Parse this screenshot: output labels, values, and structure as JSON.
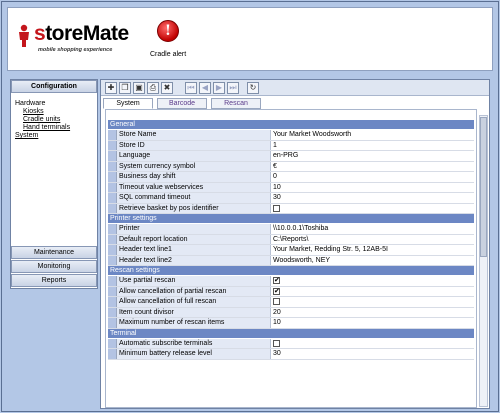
{
  "brand": {
    "logo_s": "s",
    "logo_text": "toreMate",
    "tagline": "mobile shopping experience"
  },
  "alert": {
    "label": "Cradle alert",
    "icon": "alert-icon"
  },
  "sidebar": {
    "configuration": "Configuration",
    "tree": {
      "hardware": "Hardware",
      "kiosks": "Kiosks",
      "cradle_units": "Cradle units",
      "hand_terminals": "Hand terminals",
      "system": "System"
    },
    "maintenance": "Maintenance",
    "monitoring": "Monitoring",
    "reports": "Reports"
  },
  "toolbar": {
    "icons": [
      "new-icon",
      "copy-icon",
      "save-icon",
      "print-icon",
      "delete-icon",
      "first-icon",
      "prev-icon",
      "next-icon",
      "last-icon",
      "refresh-icon"
    ]
  },
  "tabs": [
    "System",
    "Barcode",
    "Rescan"
  ],
  "sections": {
    "general": "General",
    "printer": "Printer settings",
    "rescan": "Rescan settings",
    "terminal": "Terminal"
  },
  "rows": {
    "store_name": {
      "name": "Store Name",
      "value": "Your Market Woodsworth"
    },
    "store_id": {
      "name": "Store ID",
      "value": "1"
    },
    "language": {
      "name": "Language",
      "value": "en-PRG"
    },
    "currency": {
      "name": "System currency symbol",
      "value": "€"
    },
    "day_shift": {
      "name": "Business day shift",
      "value": "0"
    },
    "timeout": {
      "name": "Timeout value webservices",
      "value": "10"
    },
    "sql_timeout": {
      "name": "SQL command timeout",
      "value": "30"
    },
    "retrieve_basket": {
      "name": "Retrieve basket by pos identifier",
      "checked": false
    },
    "printer": {
      "name": "Printer",
      "value": "\\\\10.0.0.1\\Toshiba"
    },
    "report_loc": {
      "name": "Default report location",
      "value": "C:\\Reports\\"
    },
    "header1": {
      "name": "Header text line1",
      "value": "Your Market, Redding Str. 5, 12AB-5I"
    },
    "header2": {
      "name": "Header text line2",
      "value": "Woodsworth, NEY"
    },
    "partial_rescan": {
      "name": "Use partial rescan",
      "checked": true
    },
    "allow_partial": {
      "name": "Allow cancellation of partial rescan",
      "checked": true
    },
    "allow_full": {
      "name": "Allow cancellation of full rescan",
      "checked": false
    },
    "item_divisor": {
      "name": "Item count divisor",
      "value": "20"
    },
    "max_rescan": {
      "name": "Maximum number of rescan items",
      "value": "10"
    },
    "auto_subscribe": {
      "name": "Automatic subscribe terminals",
      "checked": false
    },
    "min_battery": {
      "name": "Minimum battery release level",
      "value": "30"
    }
  }
}
